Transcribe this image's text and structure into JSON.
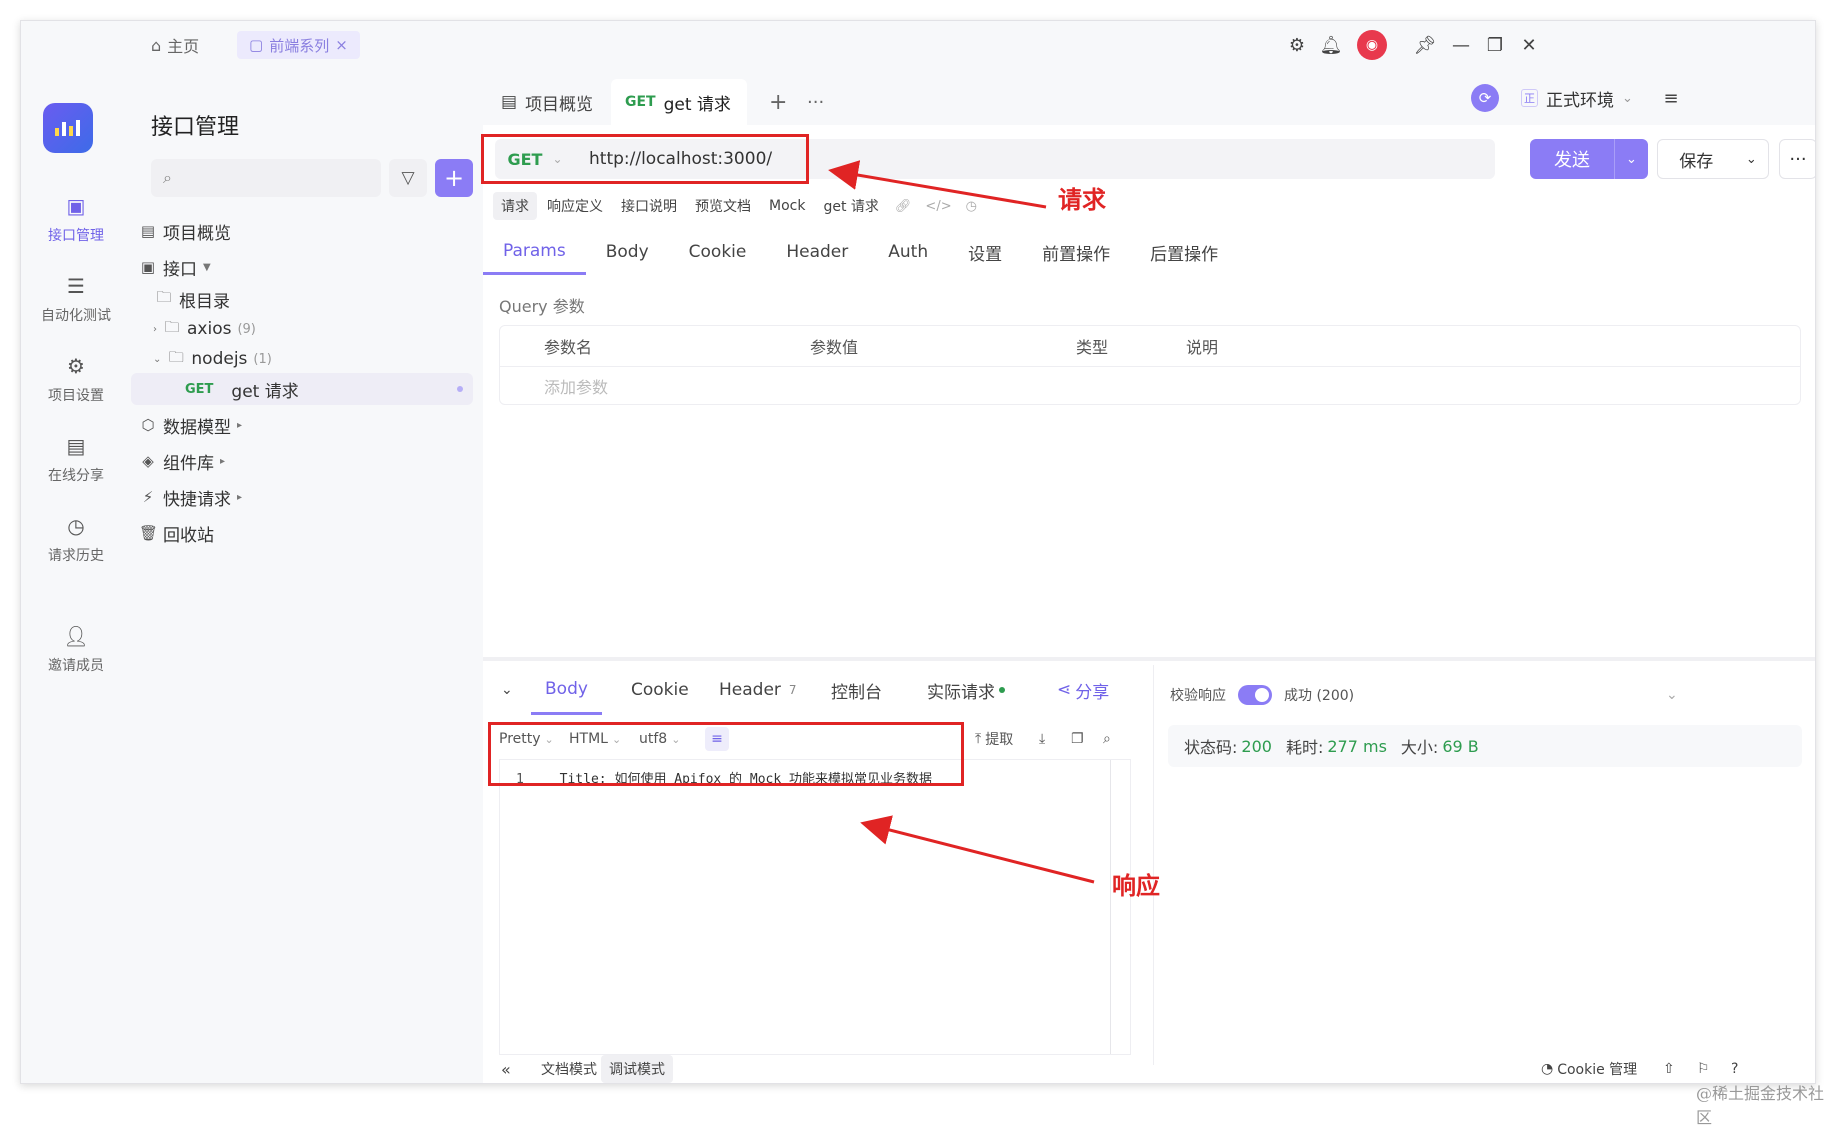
{
  "titlebar": {
    "home_label": "主页",
    "tab_label": "前端系列",
    "close_glyph": "×"
  },
  "rail": {
    "items": [
      {
        "label": "接口管理"
      },
      {
        "label": "自动化测试"
      },
      {
        "label": "项目设置"
      },
      {
        "label": "在线分享"
      },
      {
        "label": "请求历史"
      },
      {
        "label": "邀请成员"
      }
    ]
  },
  "tree": {
    "title": "接口管理",
    "search_placeholder": "",
    "items": [
      {
        "label": "项目概览"
      },
      {
        "label": "接口"
      },
      {
        "label": "根目录"
      },
      {
        "label": "axios",
        "count": "(9)"
      },
      {
        "label": "nodejs",
        "count": "(1)"
      },
      {
        "method": "GET",
        "label": "get 请求"
      },
      {
        "label": "数据模型"
      },
      {
        "label": "组件库"
      },
      {
        "label": "快捷请求"
      },
      {
        "label": "回收站"
      }
    ]
  },
  "main": {
    "tabs": [
      {
        "label": "项目概览"
      },
      {
        "method": "GET",
        "label": "get 请求"
      }
    ],
    "env_label": "正式环境",
    "env_chip": "正",
    "method": "GET",
    "url": "http://localhost:3000/",
    "send_label": "发送",
    "save_label": "保存",
    "subtabs": [
      "请求",
      "响应定义",
      "接口说明",
      "预览文档",
      "Mock",
      "get 请求"
    ],
    "param_tabs": [
      "Params",
      "Body",
      "Cookie",
      "Header",
      "Auth",
      "设置",
      "前置操作",
      "后置操作"
    ],
    "query_label": "Query 参数",
    "query_headers": [
      "参数名",
      "参数值",
      "类型",
      "说明"
    ],
    "query_add": "添加参数"
  },
  "response": {
    "tabs": {
      "body": "Body",
      "cookie": "Cookie",
      "header": "Header",
      "header_count": "7",
      "console": "控制台",
      "actual": "实际请求"
    },
    "share_label": "分享",
    "format": {
      "pretty": "Pretty",
      "html": "HTML",
      "encoding": "utf8",
      "extract": "提取"
    },
    "code": {
      "line_no": "1",
      "text": "Title: 如何使用 Apifox 的 Mock 功能来模拟常见业务数据"
    },
    "validate_label": "校验响应",
    "validate_result": "成功 (200)",
    "status_label": "状态码:",
    "status_value": "200",
    "time_label": "耗时:",
    "time_value": "277 ms",
    "size_label": "大小:",
    "size_value": "69 B"
  },
  "footer": {
    "doc_mode": "文档模式",
    "debug_mode": "调试模式",
    "cookie_mgr": "Cookie 管理"
  },
  "annotations": {
    "request": "请求",
    "response": "响应"
  },
  "watermark": "@稀土掘金技术社区",
  "colors": {
    "accent": "#8b7cf5",
    "get": "#2e9c4f",
    "annotation": "#e02424"
  }
}
